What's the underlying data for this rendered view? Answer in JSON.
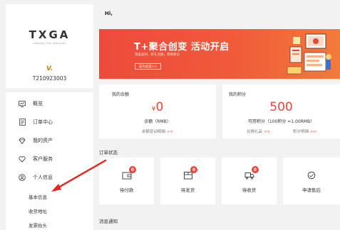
{
  "profile": {
    "logo_text": "TXGA",
    "logo_sub": "LEADING THE INDUSTRY",
    "vip_mark": "V.",
    "user_id": "T210923003"
  },
  "sidebar": {
    "items": [
      {
        "label": "概览",
        "icon": "overview-icon"
      },
      {
        "label": "订单中心",
        "icon": "order-center-icon"
      },
      {
        "label": "我的资产",
        "icon": "assets-icon"
      },
      {
        "label": "客户服务",
        "icon": "heart-icon"
      },
      {
        "label": "个人信息",
        "icon": "user-icon"
      }
    ],
    "sub_items": [
      "基本信息",
      "收货地址",
      "发票抬头"
    ]
  },
  "main": {
    "greeting": "Hi,",
    "banner": {
      "title": "T+聚合创变 活动开启",
      "subtitle": "现金返利、好礼兑换，等你参与",
      "button": "成为创变>>"
    },
    "balance": {
      "title": "我的余额",
      "currency": "¥",
      "amount": "0",
      "label": "余额（RMB）",
      "link": "余额变动明细",
      "link_arrow": ">>"
    },
    "points": {
      "title": "我的积分",
      "amount": "500",
      "label": "可用积分（100积分 =1.00RMB）",
      "link1": "兑换礼品",
      "link1_arrow": ">>",
      "link2": "积分明细",
      "link2_arrow": ">>"
    },
    "order_status_title": "订单状态",
    "orders": [
      {
        "label": "待付款",
        "badge": "0",
        "icon": "wallet-icon"
      },
      {
        "label": "待发货",
        "badge": "0",
        "icon": "package-icon"
      },
      {
        "label": "待收货",
        "badge": "0",
        "icon": "truck-icon"
      },
      {
        "label": "申请售后",
        "badge": "",
        "icon": "after-sale-icon"
      }
    ],
    "messages_title": "消息通知"
  },
  "colors": {
    "accent": "#e8453c",
    "banner": "#ef5a3a",
    "arrow": "#e8231e"
  }
}
